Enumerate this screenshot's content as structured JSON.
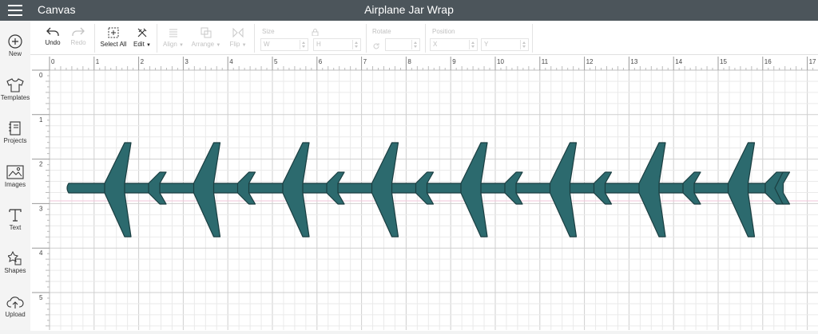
{
  "header": {
    "app_title": "Canvas",
    "doc_title": "Airplane Jar Wrap"
  },
  "sidebar": {
    "items": [
      {
        "label": "New",
        "icon": "plus-circle-icon"
      },
      {
        "label": "Templates",
        "icon": "shirt-icon"
      },
      {
        "label": "Projects",
        "icon": "notebook-icon"
      },
      {
        "label": "Images",
        "icon": "image-icon"
      },
      {
        "label": "Text",
        "icon": "text-t-icon"
      },
      {
        "label": "Shapes",
        "icon": "shapes-icon"
      },
      {
        "label": "Upload",
        "icon": "cloud-upload-icon"
      }
    ]
  },
  "toolbar": {
    "undo_label": "Undo",
    "redo_label": "Redo",
    "select_all_label": "Select All",
    "edit_label": "Edit",
    "align_label": "Align",
    "arrange_label": "Arrange",
    "flip_label": "Flip",
    "size_label": "Size",
    "w_label": "W",
    "h_label": "H",
    "rotate_label": "Rotate",
    "position_label": "Position",
    "x_label": "X",
    "y_label": "Y"
  },
  "ruler": {
    "h_ticks": [
      "0",
      "1",
      "2",
      "3",
      "4",
      "5",
      "6",
      "7",
      "8",
      "9",
      "10",
      "11",
      "12",
      "13",
      "14",
      "15",
      "16",
      "17"
    ],
    "v_ticks": [
      "0",
      "1",
      "2",
      "3",
      "4",
      "5"
    ]
  },
  "canvas": {
    "design_color": "#2c6a6e",
    "plane_count": 8
  }
}
